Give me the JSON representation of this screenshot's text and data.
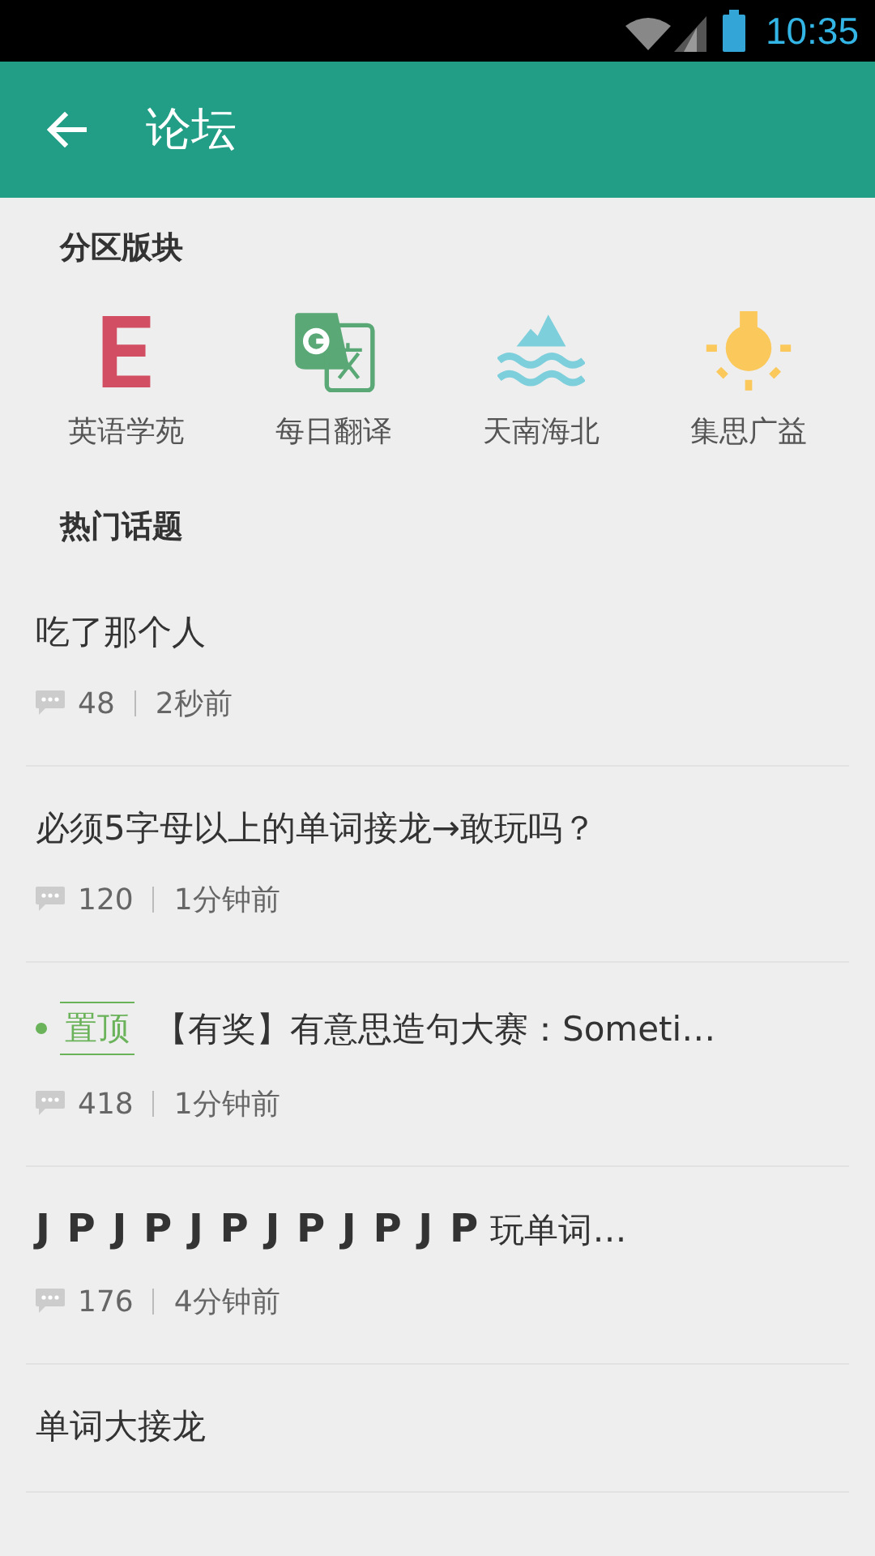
{
  "status_bar": {
    "time": "10:35"
  },
  "app_bar": {
    "title": "论坛"
  },
  "sections_header": "分区版块",
  "sections": [
    {
      "kind": "letter",
      "label": "英语学苑",
      "color": "#d24e62"
    },
    {
      "kind": "translate",
      "label": "每日翻译",
      "color": "#5aa875"
    },
    {
      "kind": "landscape",
      "label": "天南海北",
      "color": "#7ecfdc"
    },
    {
      "kind": "bulb",
      "label": "集思广益",
      "color": "#fbc85b"
    }
  ],
  "topics_header": "热门话题",
  "topics": [
    {
      "title": "吃了那个人",
      "pinned": false,
      "comments": "48",
      "time": "2秒前"
    },
    {
      "title": "必须5字母以上的单词接龙→敢玩吗？",
      "pinned": false,
      "comments": "120",
      "time": "1分钟前"
    },
    {
      "title": "【有奖】有意思造句大赛：Someti…",
      "pinned": true,
      "badge": "置顶",
      "comments": "418",
      "time": "1分钟前"
    },
    {
      "title": "**J P J P J P J P J P J P** 玩单词…",
      "pinned": false,
      "comments": "176",
      "time": "4分钟前"
    },
    {
      "title": "单词大接龙",
      "pinned": false
    }
  ]
}
